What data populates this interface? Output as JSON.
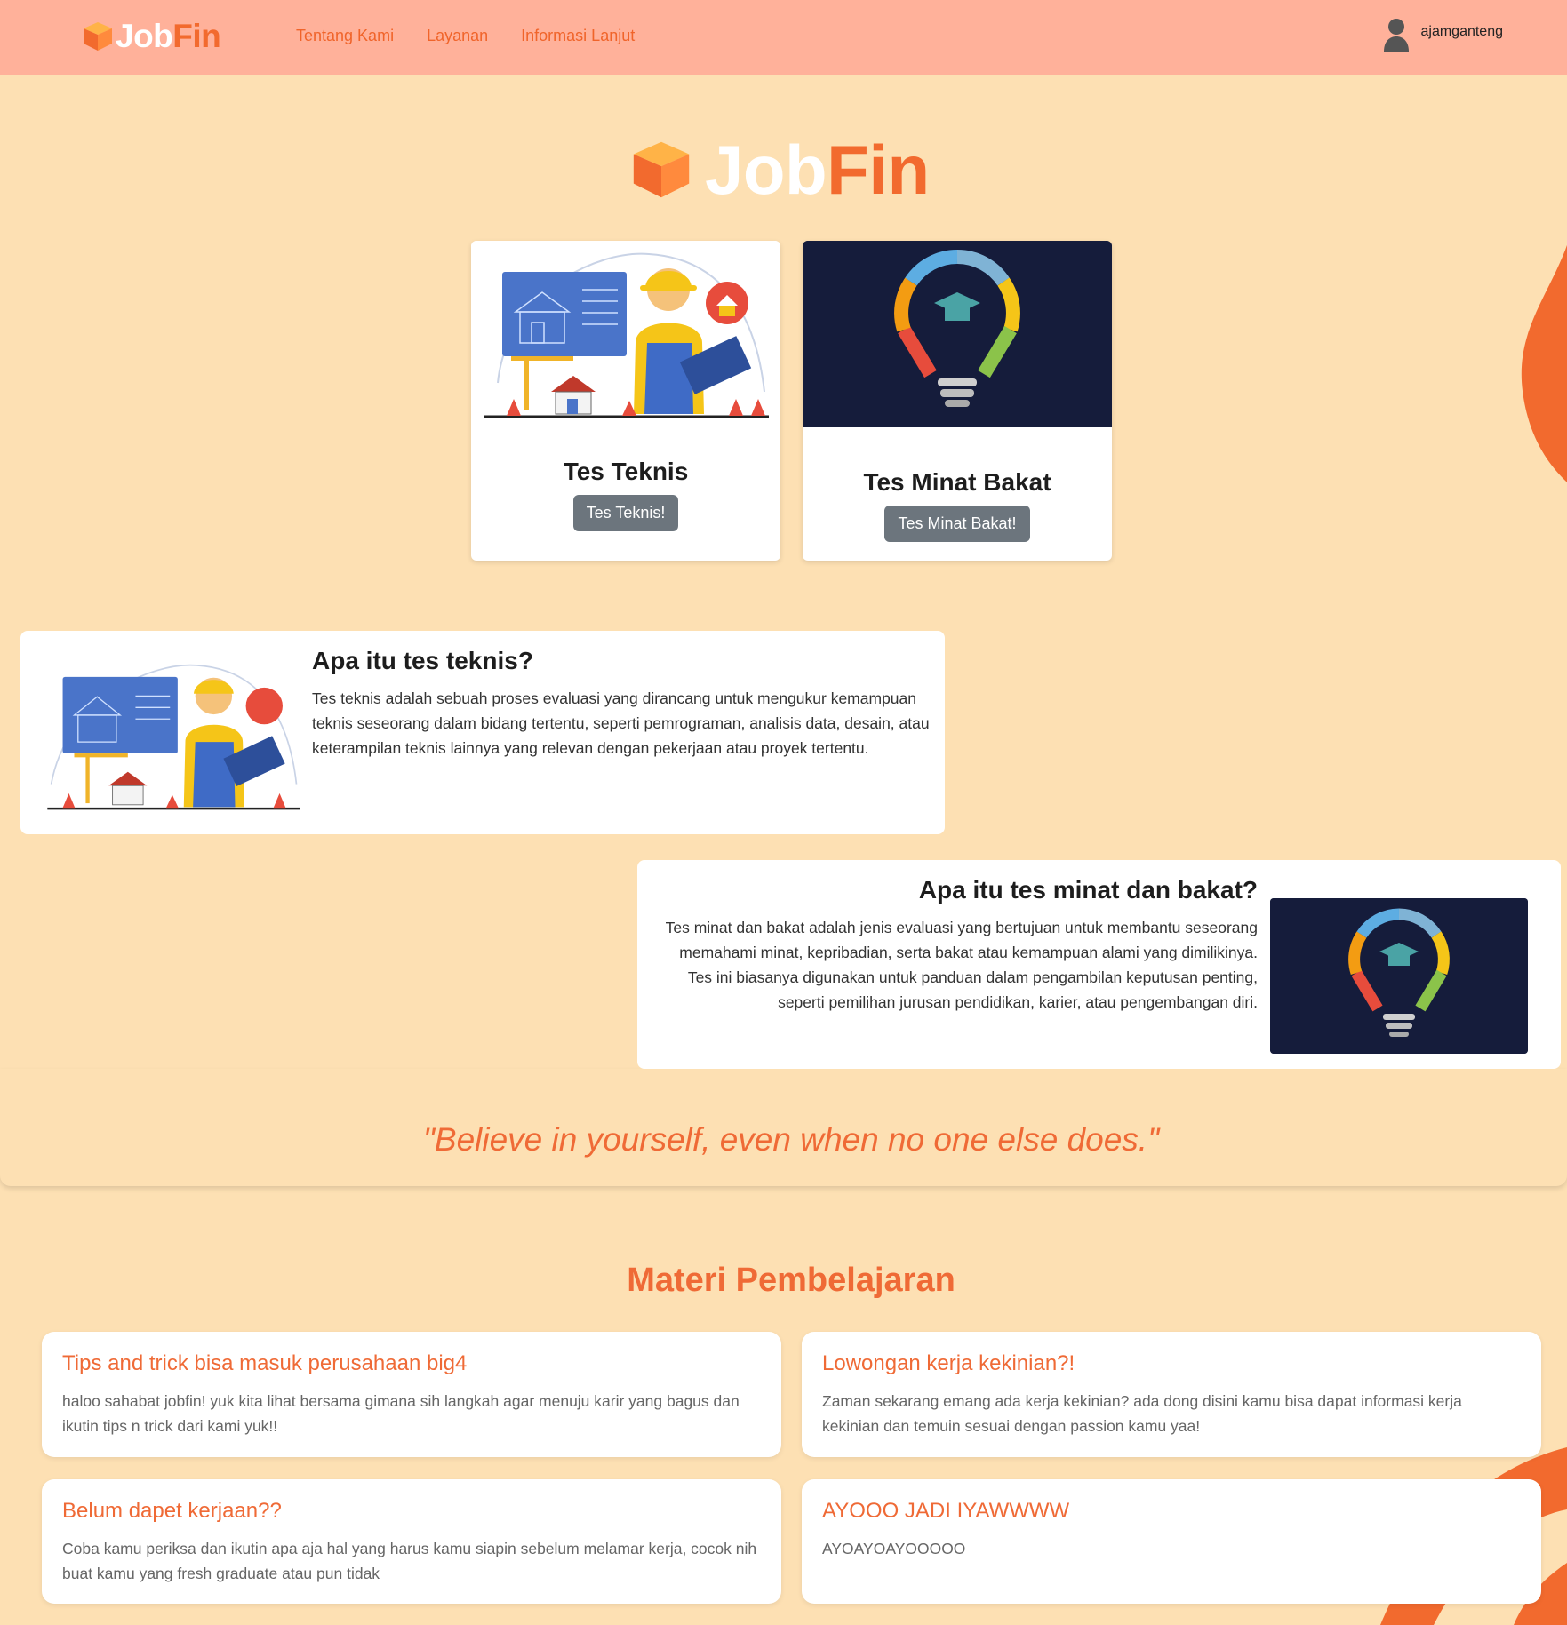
{
  "brand": {
    "job": "Job",
    "fin": "Fin"
  },
  "nav": {
    "links": [
      "Tentang Kami",
      "Layanan",
      "Informasi Lanjut"
    ],
    "username": "ajamganteng"
  },
  "tests": [
    {
      "title": "Tes Teknis",
      "button": "Tes Teknis!"
    },
    {
      "title": "Tes Minat Bakat",
      "button": "Tes Minat Bakat!"
    }
  ],
  "info": {
    "teknis": {
      "title": "Apa itu tes teknis?",
      "text": "Tes teknis adalah sebuah proses evaluasi yang dirancang untuk mengukur kemampuan teknis seseorang dalam bidang tertentu, seperti pemrograman, analisis data, desain, atau keterampilan teknis lainnya yang relevan dengan pekerjaan atau proyek tertentu."
    },
    "minat": {
      "title": "Apa itu tes minat dan bakat?",
      "text": "Tes minat dan bakat adalah jenis evaluasi yang bertujuan untuk membantu seseorang memahami minat, kepribadian, serta bakat atau kemampuan alami yang dimilikinya. Tes ini biasanya digunakan untuk panduan dalam pengambilan keputusan penting, seperti pemilihan jurusan pendidikan, karier, atau pengembangan diri."
    }
  },
  "quote": "\"Believe in yourself, even when no one else does.\"",
  "materi": {
    "title": "Materi Pembelajaran",
    "items": [
      {
        "title": "Tips and trick bisa masuk perusahaan big4",
        "desc": "haloo sahabat jobfin! yuk kita lihat bersama gimana sih langkah agar menuju karir yang bagus dan ikutin tips n trick dari kami yuk!!"
      },
      {
        "title": "Lowongan kerja kekinian?!",
        "desc": "Zaman sekarang emang ada kerja kekinian? ada dong disini kamu bisa dapat informasi kerja kekinian dan temuin sesuai dengan passion kamu yaa!"
      },
      {
        "title": "Belum dapet kerjaan??",
        "desc": "Coba kamu periksa dan ikutin apa aja hal yang harus kamu siapin sebelum melamar kerja, cocok nih buat kamu yang fresh graduate atau pun tidak"
      },
      {
        "title": "AYOOO JADI IYAWWWW",
        "desc": "AYOAYOAYOOOOO"
      }
    ]
  },
  "colors": {
    "accent": "#ef6a36",
    "navbar": "#ffb19a",
    "background": "#fde0b3",
    "button": "#6c757d",
    "dark_card": "#151c3b"
  },
  "icons": [
    "cube-logo-icon",
    "user-icon",
    "engineer-illustration",
    "lightbulb-education-illustration"
  ]
}
